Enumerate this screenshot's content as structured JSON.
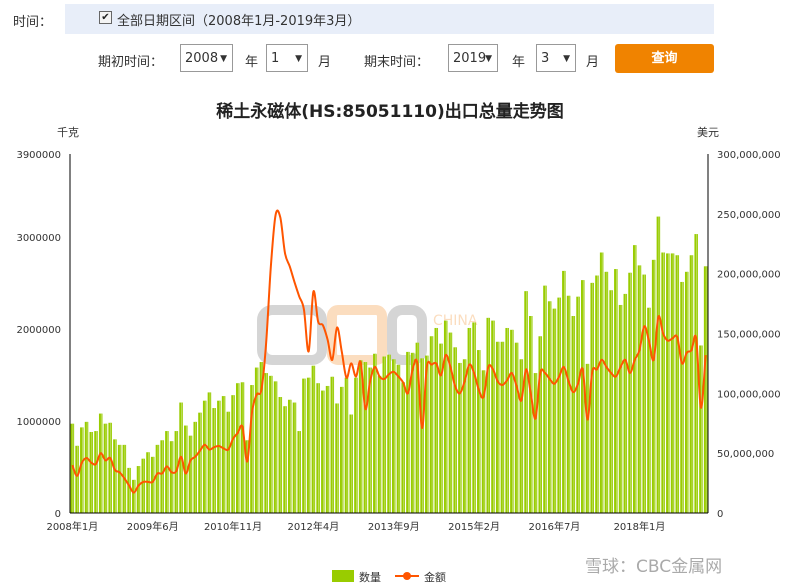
{
  "filter": {
    "time_label": "时间：",
    "all_range_checked": true,
    "all_range_label": "全部日期区间（2008年1月-2019年3月）",
    "start_label": "期初时间：",
    "start_year": "2008",
    "year_unit": "年",
    "start_month": "1",
    "month_unit": "月",
    "end_label": "期末时间：",
    "end_year": "2019",
    "end_month": "3",
    "query_button": "查询",
    "button_color": "#f08300"
  },
  "chart_data": {
    "type": "bar+line",
    "title": "稀土永磁体(HS:85051110)出口总量走势图",
    "left_axis": {
      "unit": "千克",
      "range": [
        0,
        3900000
      ],
      "ticks": [
        "0",
        "1000000",
        "2000000",
        "3000000",
        "3900000"
      ],
      "tick_values": [
        0,
        1000000,
        2000000,
        3000000,
        3900000
      ]
    },
    "right_axis": {
      "unit": "美元",
      "range": [
        0,
        300000000
      ],
      "ticks": [
        "0",
        "50,000,000",
        "100,000,000",
        "150,000,000",
        "200,000,000",
        "250,000,000",
        "300,000,000"
      ],
      "tick_values": [
        0,
        50000000,
        100000000,
        150000000,
        200000000,
        250000000,
        300000000
      ]
    },
    "x_start": "2008-01",
    "x_end": "2019-03",
    "x_tick_labels": [
      {
        "label": "2008年1月",
        "month": "2008-01"
      },
      {
        "label": "2009年6月",
        "month": "2009-06"
      },
      {
        "label": "2010年11月",
        "month": "2010-11"
      },
      {
        "label": "2012年4月",
        "month": "2012-04"
      },
      {
        "label": "2013年9月",
        "month": "2013-09"
      },
      {
        "label": "2015年2月",
        "month": "2015-02"
      },
      {
        "label": "2016年7月",
        "month": "2016-07"
      },
      {
        "label": "2018年1月",
        "month": "2018-01"
      }
    ],
    "grid": false,
    "legend_position": "bottom",
    "series": [
      {
        "name": "数量",
        "type": "bar",
        "axis": "left",
        "color": "#99cc00",
        "values": [
          970000,
          730000,
          930000,
          990000,
          880000,
          890000,
          1080000,
          970000,
          980000,
          800000,
          740000,
          740000,
          490000,
          360000,
          510000,
          590000,
          660000,
          610000,
          740000,
          790000,
          890000,
          780000,
          890000,
          1200000,
          950000,
          840000,
          990000,
          1090000,
          1220000,
          1310000,
          1140000,
          1220000,
          1270000,
          1100000,
          1280000,
          1410000,
          1420000,
          790000,
          1390000,
          1580000,
          1640000,
          1520000,
          1490000,
          1430000,
          1260000,
          1160000,
          1230000,
          1200000,
          890000,
          1460000,
          1470000,
          1600000,
          1410000,
          1330000,
          1380000,
          1480000,
          1190000,
          1370000,
          1470000,
          1070000,
          1470000,
          1660000,
          1640000,
          1580000,
          1730000,
          1490000,
          1700000,
          1720000,
          1670000,
          1610000,
          1420000,
          1750000,
          1740000,
          1850000,
          1680000,
          1710000,
          1920000,
          2010000,
          1840000,
          2090000,
          1960000,
          1800000,
          1630000,
          1670000,
          2010000,
          2070000,
          1770000,
          1550000,
          2120000,
          2090000,
          1860000,
          1860000,
          2010000,
          1990000,
          1850000,
          1670000,
          2410000,
          2140000,
          1520000,
          1920000,
          2470000,
          2300000,
          2220000,
          2340000,
          2630000,
          2360000,
          2140000,
          2350000,
          2530000,
          1620000,
          2500000,
          2580000,
          2830000,
          2620000,
          2420000,
          2650000,
          2260000,
          2380000,
          2610000,
          2910000,
          2690000,
          2590000,
          2230000,
          2750000,
          3220000,
          2830000,
          2820000,
          2820000,
          2800000,
          2510000,
          2620000,
          2800000,
          3030000,
          1820000,
          2680000
        ]
      },
      {
        "name": "金额",
        "type": "line",
        "axis": "right",
        "color": "#ff5500",
        "values": [
          40000000,
          31000000,
          42000000,
          46000000,
          42000000,
          41000000,
          50000000,
          44000000,
          46000000,
          36000000,
          34000000,
          29000000,
          23000000,
          17000000,
          23000000,
          26000000,
          26000000,
          26000000,
          33000000,
          33000000,
          39000000,
          34000000,
          35000000,
          47000000,
          33000000,
          44000000,
          47000000,
          52000000,
          57000000,
          53000000,
          55000000,
          56000000,
          54000000,
          53000000,
          62000000,
          67000000,
          72000000,
          43000000,
          84000000,
          99000000,
          103000000,
          142000000,
          206000000,
          249000000,
          247000000,
          217000000,
          206000000,
          193000000,
          181000000,
          170000000,
          135000000,
          185000000,
          160000000,
          157000000,
          145000000,
          128000000,
          155000000,
          135000000,
          113000000,
          125000000,
          114000000,
          126000000,
          87000000,
          110000000,
          122000000,
          114000000,
          112000000,
          116000000,
          118000000,
          114000000,
          109000000,
          100000000,
          120000000,
          125000000,
          71000000,
          122000000,
          124000000,
          125000000,
          115000000,
          132000000,
          122000000,
          106000000,
          100000000,
          110000000,
          124000000,
          117000000,
          103000000,
          97000000,
          122000000,
          120000000,
          110000000,
          107000000,
          111000000,
          117000000,
          106000000,
          94000000,
          120000000,
          100000000,
          79000000,
          117000000,
          117000000,
          112000000,
          108000000,
          114000000,
          122000000,
          110000000,
          101000000,
          108000000,
          120000000,
          78000000,
          118000000,
          120000000,
          128000000,
          122000000,
          117000000,
          114000000,
          122000000,
          128000000,
          117000000,
          128000000,
          136000000,
          156000000,
          144000000,
          128000000,
          164000000,
          150000000,
          144000000,
          146000000,
          147000000,
          125000000,
          134000000,
          136000000,
          146000000,
          88000000,
          132000000
        ]
      }
    ]
  },
  "watermark": {
    "center_logo": "CBC CHINA BAIKO",
    "corner": "雪球：CBC金属网"
  }
}
